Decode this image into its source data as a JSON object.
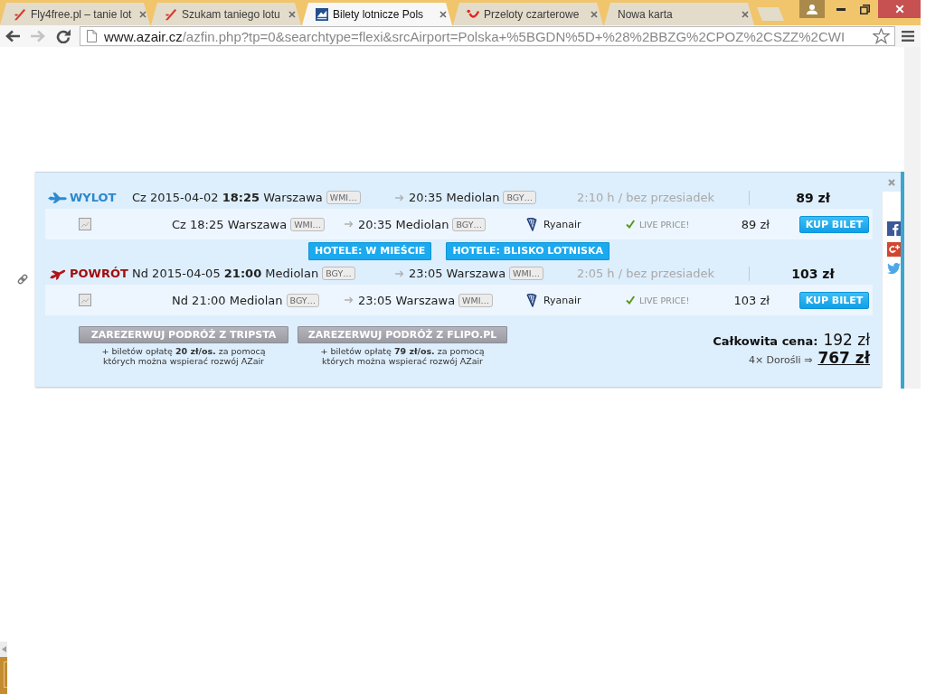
{
  "browser": {
    "tabs": [
      {
        "kind": "swoosh",
        "title": "Fly4free.pl – tanie lot",
        "selected": false
      },
      {
        "kind": "swoosh",
        "title": "Szukam taniego lotu",
        "selected": false
      },
      {
        "kind": "logo",
        "title": "Bilety lotnicze Pols",
        "selected": true
      },
      {
        "kind": "smile",
        "title": "Przeloty czarterowe",
        "selected": false
      },
      {
        "kind": "plain",
        "title": "Nowa karta",
        "selected": false
      }
    ],
    "nav": [
      {
        "kind": "back",
        "disabled": false
      },
      {
        "kind": "forward",
        "disabled": true
      },
      {
        "kind": "reload",
        "disabled": false
      }
    ],
    "address": {
      "host": "www.azair.cz",
      "path": "/azfin.php?tp=0&searchtype=flexi&srcAirport=Polska+%5BGDN%5D+%28%2BBZG%2CPOZ%2CSZZ%2CWI"
    }
  },
  "result": {
    "legs": [
      {
        "kind": "outbound",
        "label": "WYLOT",
        "departure": "Cz 2015-04-02 **18:25** Warszawa",
        "from_code": "WMI…",
        "arrival": "20:35 Mediolan",
        "to_code": "BGY…",
        "duration": "2:10 h / bez przesiadek",
        "price": "89 zł",
        "segment": {
          "departure": "Cz 18:25 Warszawa",
          "from_code": "WMI…",
          "arrival": "20:35 Mediolan",
          "to_code": "BGY…",
          "airline": "Ryanair",
          "status": "LIVE PRICE!",
          "price": "89 zł",
          "button": "KUP BILET"
        }
      },
      {
        "kind": "return",
        "label": "POWRÓT",
        "departure": "Nd 2015-04-05 **21:00** Mediolan",
        "from_code": "BGY…",
        "arrival": "23:05 Warszawa",
        "to_code": "WMI…",
        "duration": "2:05 h / bez przesiadek",
        "price": "103 zł",
        "segment": {
          "departure": "Nd 21:00 Mediolan",
          "from_code": "BGY…",
          "arrival": "23:05 Warszawa",
          "to_code": "WMI…",
          "airline": "Ryanair",
          "status": "LIVE PRICE!",
          "price": "103 zł",
          "button": "KUP BILET"
        }
      }
    ],
    "hotels": [
      "HOTELE: W MIEŚCIE",
      "HOTELE: BLISKO LOTNISKA"
    ],
    "bookings": [
      {
        "button": "ZAREZERWUJ PODRÓŻ Z TRIPSTA",
        "note": "+ biletów opłatę **20 zł/os.** za pomocą\nktórych można wspierać rozwój AZair"
      },
      {
        "button": "ZAREZERWUJ PODRÓŻ Z FLIPO.PL",
        "note": "+ biletów opłatę **79 zł/os.** za pomocą\nktórych można wspierać rozwój AZair"
      }
    ],
    "total": {
      "label": "Całkowita cena:",
      "price": "192 zł",
      "passengers": "4× Dorośli ⇒",
      "grand_total": "767 zł"
    }
  }
}
